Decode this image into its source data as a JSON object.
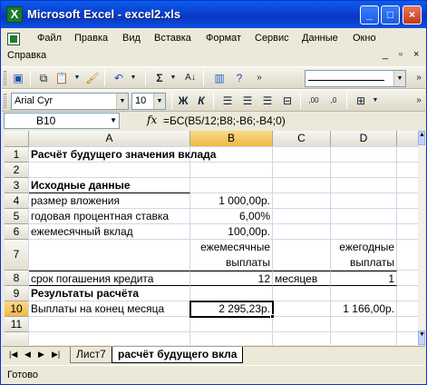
{
  "window": {
    "title": "Microsoft Excel - excel2.xls"
  },
  "menu": {
    "items": [
      "Файл",
      "Правка",
      "Вид",
      "Вставка",
      "Формат",
      "Сервис",
      "Данные",
      "Окно"
    ],
    "help": "Справка",
    "right_question": "_",
    "right_restore": "×"
  },
  "font_toolbar": {
    "font_name": "Arial Cyr",
    "font_size": "10",
    "bold": "Ж",
    "italic": "К"
  },
  "formula_bar": {
    "name_box": "B10",
    "fx": "fx",
    "formula": "=БС(B5/12;B8;-B6;-B4;0)"
  },
  "columns": [
    "A",
    "B",
    "C",
    "D"
  ],
  "rows": [
    "1",
    "2",
    "3",
    "4",
    "5",
    "6",
    "7",
    "8",
    "9",
    "10",
    "11"
  ],
  "cells": {
    "A1": "Расчёт будущего значения вклада",
    "A3": "Исходные данные",
    "A4": "размер вложения",
    "B4": "1 000,00р.",
    "A5": "годовая процентная ставка",
    "B5": "6,00%",
    "A6": "ежемесячный вклад",
    "B6": "100,00р.",
    "B7": "ежемесячные выплаты",
    "D7": "ежегодные выплаты",
    "A8": "срок погашения кредита",
    "B8": "12",
    "C8": "месяцев",
    "D8": "1",
    "A9": "Результаты расчёта",
    "A10": "Выплаты на конец месяца",
    "B10": "2 295,23р.",
    "D10": "1 166,00р."
  },
  "sheets": {
    "inactive": "Лист7",
    "active": "расчёт будущего вкла"
  },
  "status": {
    "text": "Готово"
  }
}
